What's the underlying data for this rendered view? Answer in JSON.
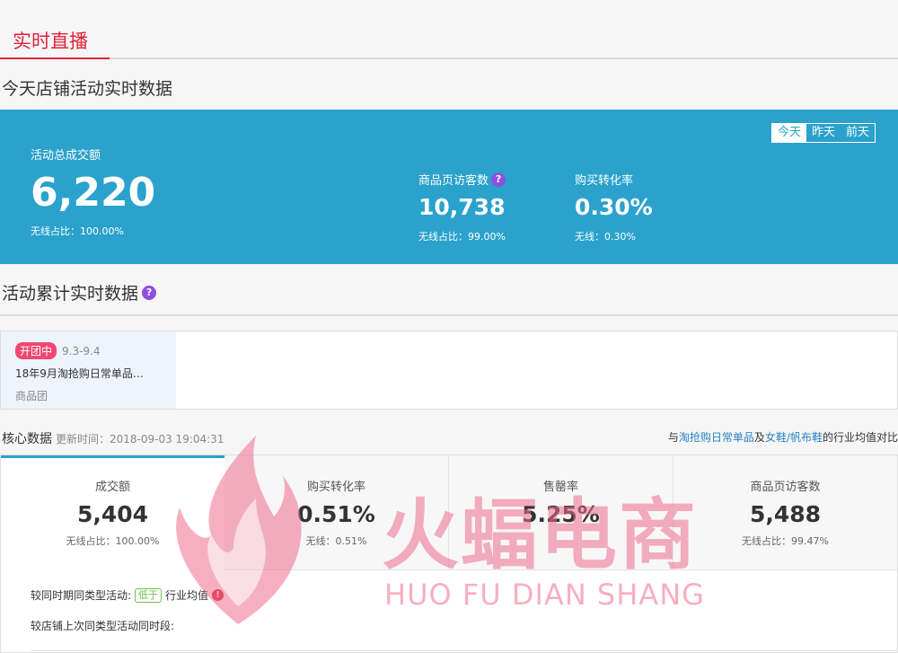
{
  "tabs": {
    "active_label": "实时直播"
  },
  "today_section": {
    "title": "今天店铺活动实时数据"
  },
  "day_switch": [
    "今天",
    "昨天",
    "前天"
  ],
  "total": {
    "label": "活动总成交额",
    "value": "6,220",
    "wireless": "无线占比：100.00%"
  },
  "visitors": {
    "label": "商品页访客数",
    "value": "10,738",
    "wireless": "无线占比：99.00%"
  },
  "conversion": {
    "label": "购买转化率",
    "value": "0.30%",
    "wireless": "无线：0.30%"
  },
  "cumulative_section": {
    "title": "活动累计实时数据"
  },
  "activity": {
    "status": "开团中",
    "date_range": "9.3-9.4",
    "name": "18年9月淘抢购日常单品…",
    "type": "商品团"
  },
  "core": {
    "title": "核心数据",
    "updated": "更新时间：2018-09-03 19:04:31",
    "compare_prefix": "与",
    "compare_link1": "淘抢购日常单品",
    "compare_mid": "及",
    "compare_link2": "女鞋/帆布鞋",
    "compare_suffix": "的行业均值对比",
    "metrics": [
      {
        "label": "成交额",
        "value": "5,404",
        "sub": "无线占比：100.00%"
      },
      {
        "label": "购买转化率",
        "value": "0.51%",
        "sub": "无线：0.51%"
      },
      {
        "label": "售罄率",
        "value": "5.25%",
        "sub": ""
      },
      {
        "label": "商品页访客数",
        "value": "5,488",
        "sub": "无线占比：99.47%"
      }
    ]
  },
  "compare_rows": {
    "row1_label": "较同时期同类型活动:",
    "row1_badge": "低于",
    "row1_suffix": "行业均值",
    "row2_label": "较店铺上次同类型活动同时段:"
  },
  "watermark": {
    "text": "火蝠电商",
    "sub": "HUO FU DIAN SHANG"
  },
  "colors": {
    "accent_red": "#e0223a",
    "panel_blue": "#2aa2cc",
    "badge_pink": "#f04870",
    "link_blue": "#2a83c6"
  }
}
